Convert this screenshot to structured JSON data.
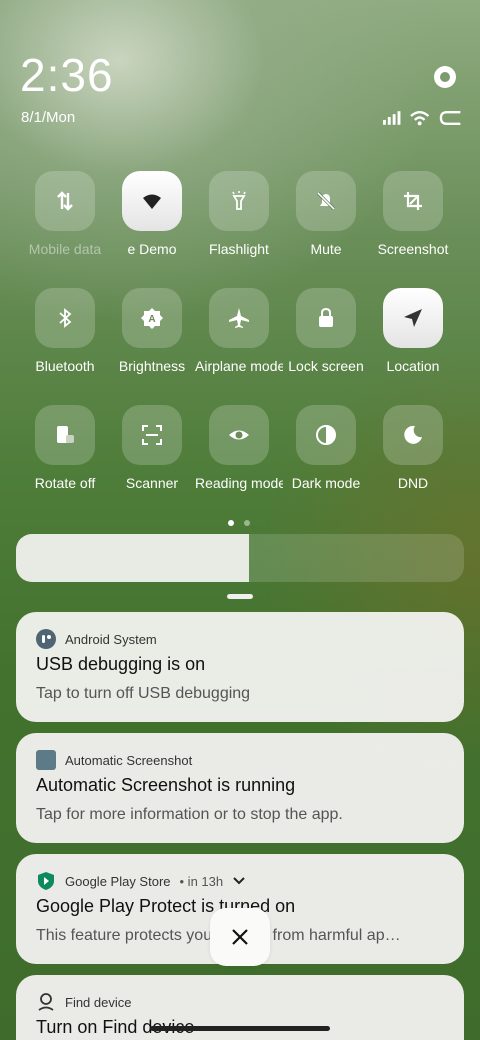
{
  "status": {
    "time": "2:36",
    "date": "8/1/Mon"
  },
  "icons": {
    "settings": "gear-icon",
    "signal": "signal-icon",
    "wifi": "wifi-icon",
    "battery": "battery-icon"
  },
  "tiles": [
    {
      "label": "Mobile data",
      "icon": "mobile-data-icon",
      "active": false,
      "dim": true
    },
    {
      "label": "e    Demo",
      "icon": "wifi-icon",
      "active": true,
      "dim": false
    },
    {
      "label": "Flashlight",
      "icon": "flashlight-icon",
      "active": false,
      "dim": false
    },
    {
      "label": "Mute",
      "icon": "mute-icon",
      "active": false,
      "dim": false
    },
    {
      "label": "Screenshot",
      "icon": "crop-icon",
      "active": false,
      "dim": false
    },
    {
      "label": "Bluetooth",
      "icon": "bluetooth-icon",
      "active": false,
      "dim": false
    },
    {
      "label": "Brightness",
      "icon": "auto-brightness-icon",
      "active": false,
      "dim": false
    },
    {
      "label": "Airplane mode",
      "icon": "airplane-icon",
      "active": false,
      "dim": false
    },
    {
      "label": "Lock screen",
      "icon": "lock-icon",
      "active": false,
      "dim": false
    },
    {
      "label": "Location",
      "icon": "location-icon",
      "active": true,
      "dim": false
    },
    {
      "label": "Rotate off",
      "icon": "rotate-icon",
      "active": false,
      "dim": false
    },
    {
      "label": "Scanner",
      "icon": "scanner-icon",
      "active": false,
      "dim": false
    },
    {
      "label": "Reading mode",
      "icon": "eye-icon",
      "active": false,
      "dim": false
    },
    {
      "label": "Dark mode",
      "icon": "dark-mode-icon",
      "active": false,
      "dim": false
    },
    {
      "label": "DND",
      "icon": "moon-icon",
      "active": false,
      "dim": false
    }
  ],
  "brightness": {
    "level": 0.52
  },
  "notifications": [
    {
      "app": "Android System",
      "title": "USB debugging is on",
      "body": "Tap to turn off USB debugging",
      "meta": ""
    },
    {
      "app": "Automatic Screenshot",
      "title": "Automatic Screenshot is running",
      "body": "Tap for more information or to stop the app.",
      "meta": ""
    },
    {
      "app": "Google Play Store",
      "title": "Google Play Protect is turned on",
      "body": "This feature protects your device from harmful ap…",
      "meta": "• in 13h"
    },
    {
      "app": "Find device",
      "title": "Turn on Find device",
      "body": "",
      "meta": ""
    }
  ],
  "colors": {
    "accent": "#ffffff",
    "card": "#f0f0ec",
    "play_green": "#0f8a5f"
  }
}
